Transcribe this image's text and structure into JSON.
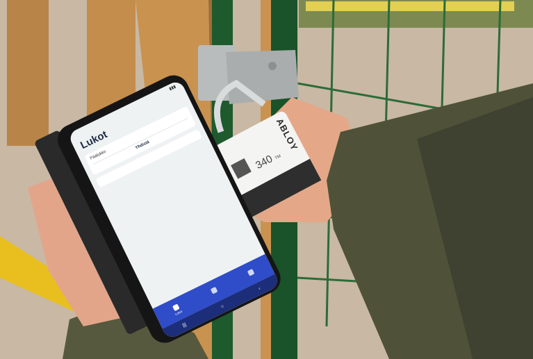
{
  "phone": {
    "status_time": "",
    "title": "Lukot",
    "card": {
      "label": "Päälukko",
      "sub": "",
      "row": "",
      "action": "Yhdistä"
    },
    "card2": {
      "label": "",
      "sub": ""
    },
    "nav": [
      {
        "label": "Lukot",
        "icon": "lock-icon",
        "active": true
      },
      {
        "label": "",
        "icon": "key-icon",
        "active": false
      },
      {
        "label": "",
        "icon": "menu-icon",
        "active": false
      }
    ],
    "system_nav": [
      "|||",
      "○",
      "‹"
    ]
  },
  "padlock": {
    "brand": "ABLOY",
    "model": "340",
    "model_suffix": "TM"
  },
  "colors": {
    "fence_green": "#1f5a2c",
    "app_blue": "#2f4cc9",
    "wood": "#c98f4c",
    "jacket": "#4d4f35",
    "yellow_marking": "#f2c52a"
  }
}
